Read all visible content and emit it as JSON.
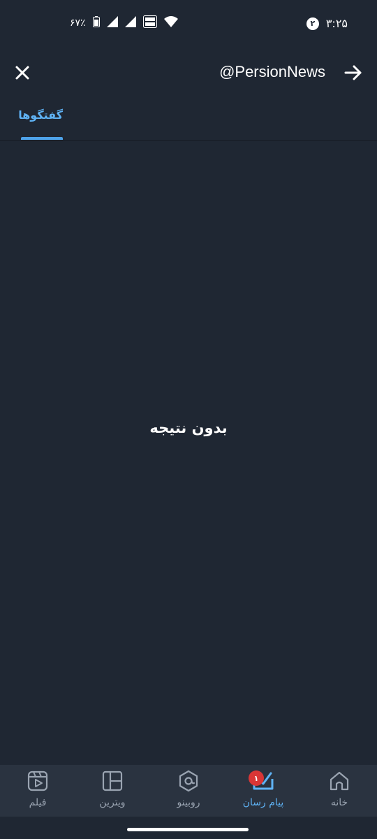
{
  "status_bar": {
    "time": "۳:۲۵",
    "notification_count": "۲",
    "battery_text": "۶۷٪",
    "icons": [
      "battery-icon",
      "signal-icon",
      "signal-icon",
      "volte-icon",
      "wifi-icon"
    ]
  },
  "header": {
    "search_query": "@PersionNews",
    "close_icon": "close-icon",
    "back_icon": "arrow-right-icon"
  },
  "tabs": [
    {
      "label": "گفتگوها",
      "active": true
    }
  ],
  "empty_state": {
    "message": "بدون نتیجه"
  },
  "bottom_nav": {
    "items": [
      {
        "label": "خانه",
        "icon": "home-icon",
        "active": false
      },
      {
        "label": "پیام رسان",
        "icon": "messenger-icon",
        "active": true,
        "badge": "۱"
      },
      {
        "label": "روبینو",
        "icon": "rubino-icon",
        "active": false
      },
      {
        "label": "ویترین",
        "icon": "showcase-icon",
        "active": false
      },
      {
        "label": "فیلم",
        "icon": "film-icon",
        "active": false
      }
    ]
  },
  "colors": {
    "background": "#1f2733",
    "nav_background": "#2a3340",
    "accent": "#5fb3f5",
    "badge": "#d93636",
    "inactive_label": "#9aa4b1"
  }
}
